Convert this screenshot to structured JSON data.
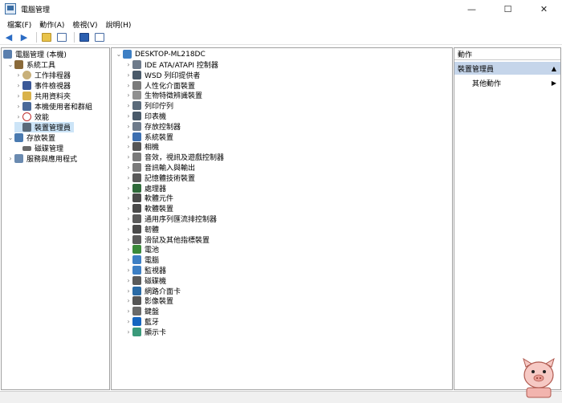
{
  "window": {
    "title": "電腦管理",
    "minimize": "—",
    "maximize": "☐",
    "close": "✕"
  },
  "menu": [
    "檔案(F)",
    "動作(A)",
    "檢視(V)",
    "說明(H)"
  ],
  "tree": {
    "root": "電腦管理 (本機)",
    "system_tools": "系統工具",
    "items": [
      "工作排程器",
      "事件檢視器",
      "共用資料夾",
      "本機使用者和群組",
      "效能",
      "裝置管理員"
    ],
    "storage": "存放裝置",
    "disk_management": "磁碟管理",
    "services": "服務與應用程式"
  },
  "devices": {
    "computer": "DESKTOP-ML218DC",
    "items": [
      "IDE ATA/ATAPI 控制器",
      "WSD 列印提供者",
      "人性化介面裝置",
      "生物特徵辨識裝置",
      "列印佇列",
      "印表機",
      "存放控制器",
      "系統裝置",
      "相機",
      "音效，視訊及遊戲控制器",
      "音訊輸入與輸出",
      "記憶體技術裝置",
      "處理器",
      "軟體元件",
      "軟體裝置",
      "通用序列匯流排控制器",
      "韌體",
      "滑鼠及其他指標裝置",
      "電池",
      "電腦",
      "監視器",
      "磁碟機",
      "網路介面卡",
      "影像裝置",
      "鍵盤",
      "藍牙",
      "顯示卡"
    ],
    "icon_names": [
      "ide-controller-icon",
      "printer-icon",
      "hid-icon",
      "biometric-icon",
      "print-queue-icon",
      "printer-icon",
      "storage-controller-icon",
      "system-device-icon",
      "camera-icon",
      "sound-icon",
      "audio-io-icon",
      "memory-icon",
      "processor-icon",
      "software-component-icon",
      "software-device-icon",
      "usb-icon",
      "firmware-icon",
      "mouse-icon",
      "battery-icon",
      "computer-icon",
      "monitor-icon",
      "disk-drive-icon",
      "network-adapter-icon",
      "imaging-device-icon",
      "keyboard-icon",
      "bluetooth-icon",
      "display-adapter-icon"
    ],
    "icon_colors": [
      "#6e7b8b",
      "#4a5a6a",
      "#7a7a7a",
      "#909090",
      "#5a6a7a",
      "#4a5a6a",
      "#6e7b8b",
      "#3d6fb0",
      "#555555",
      "#7a7a7a",
      "#7a7a7a",
      "#5a5a5a",
      "#2f6a3a",
      "#4a4a4a",
      "#4a4a4a",
      "#5a5a5a",
      "#4a4a4a",
      "#5a5a5a",
      "#3a8a3a",
      "#3d7fc4",
      "#3d7fc4",
      "#5a5a5a",
      "#2a6aa5",
      "#555555",
      "#6a6a6a",
      "#1565c0",
      "#3a9a7a"
    ]
  },
  "actions": {
    "header": "動作",
    "selected": "裝置管理員",
    "more": "其他動作"
  }
}
